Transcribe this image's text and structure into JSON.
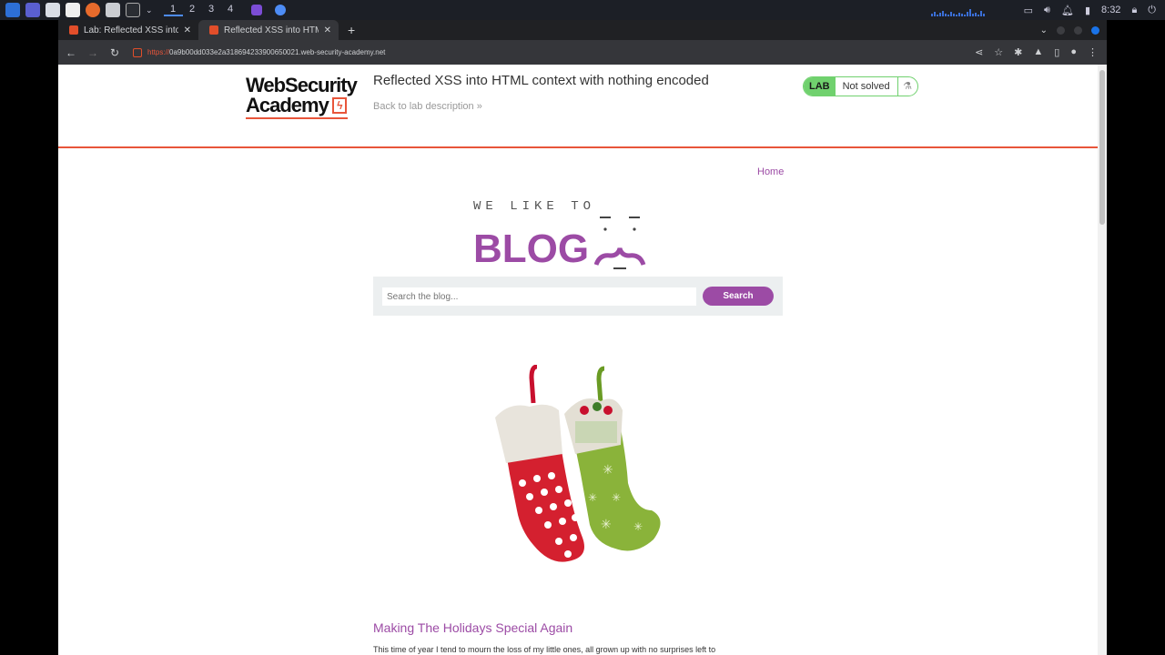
{
  "taskbar": {
    "workspaces": [
      "1",
      "2",
      "3",
      "4"
    ],
    "clock": "8:32"
  },
  "browser": {
    "tabs": [
      {
        "title": "Lab: Reflected XSS into HT",
        "active": false
      },
      {
        "title": "Reflected XSS into HTML c",
        "active": true
      }
    ],
    "url": {
      "scheme": "https://",
      "host": "0a9b00dd033e2a318694233900650021.web-security-academy.net"
    }
  },
  "header": {
    "logo_line1": "WebSecurity",
    "logo_line2": "Academy",
    "lab_title": "Reflected XSS into HTML context with nothing encoded",
    "back_link": "Back to lab description",
    "badge_label": "LAB",
    "badge_status": "Not solved"
  },
  "nav": {
    "home": "Home"
  },
  "blog_logo": {
    "tagline": "WE LIKE TO",
    "word": "BLOG"
  },
  "search": {
    "placeholder": "Search the blog...",
    "button": "Search"
  },
  "post": {
    "title": "Making The Holidays Special Again",
    "excerpt": "This time of year I tend to mourn the loss of my little ones, all grown up with no surprises left to"
  },
  "colors": {
    "accent": "#9c4ba5",
    "brand_orange": "#e8553a",
    "lab_green": "#70d16e"
  }
}
